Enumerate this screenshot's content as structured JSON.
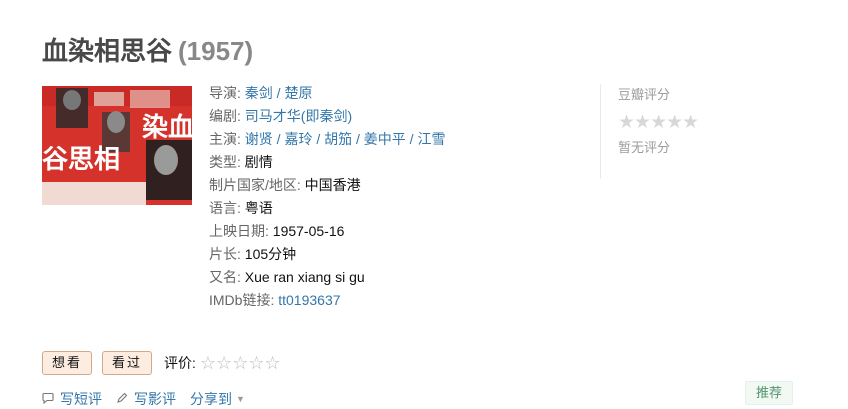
{
  "movie": {
    "title": "血染相思谷",
    "year": "(1957)"
  },
  "poster": {
    "title_chars": "染血谷思相"
  },
  "info": {
    "director_label": "导演:",
    "directors": [
      "秦剑",
      "楚原"
    ],
    "writer_label": "编剧:",
    "writers": [
      "司马才华(即秦剑)"
    ],
    "cast_label": "主演:",
    "cast": [
      "谢贤",
      "嘉玲",
      "胡笳",
      "姜中平",
      "江雪"
    ],
    "genre_label": "类型:",
    "genre": "剧情",
    "country_label": "制片国家/地区:",
    "country": "中国香港",
    "language_label": "语言:",
    "language": "粤语",
    "release_label": "上映日期:",
    "release": "1957-05-16",
    "runtime_label": "片长:",
    "runtime": "105分钟",
    "aka_label": "又名:",
    "aka": "Xue ran xiang si gu",
    "imdb_label": "IMDb链接:",
    "imdb": "tt0193637"
  },
  "rating": {
    "label": "豆瓣评分",
    "stars": "★★★★★",
    "no_rating": "暂无评分"
  },
  "actions": {
    "want_label": "想看",
    "seen_label": "看过",
    "evaluate_label": "评价:",
    "evaluate_stars": "☆☆☆☆☆"
  },
  "bottom": {
    "short_review": "写短评",
    "review": "写影评",
    "share": "分享到",
    "recommend": "推荐"
  }
}
